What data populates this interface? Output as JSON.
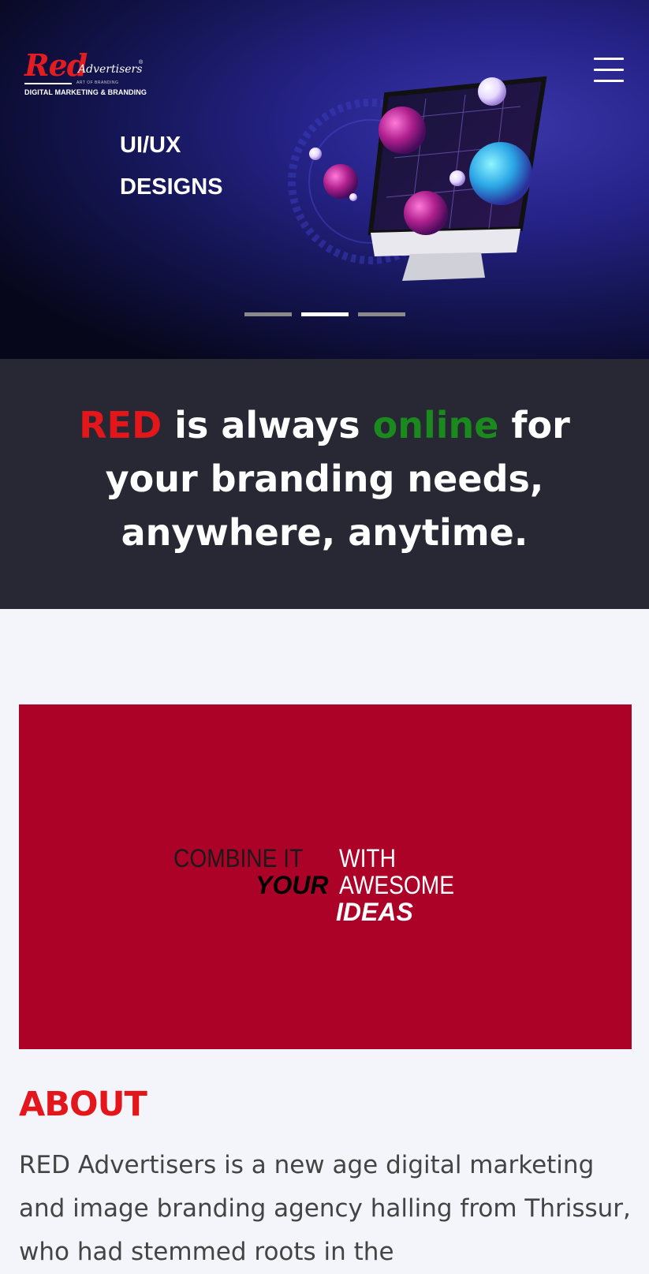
{
  "brand": {
    "logo_main": "Red",
    "logo_sub": "Advertisers",
    "logo_art": "ART OF BRANDING",
    "logo_tagline": "DIGITAL MARKETING & BRANDING"
  },
  "hero": {
    "slide_line1": "UI/UX",
    "slide_line2": "DESIGNS",
    "slides_total": 3,
    "active_slide": 2
  },
  "tagline": {
    "red_word": "RED",
    "part1": " is always ",
    "green_word": "online",
    "part2": " for",
    "line2": "your branding needs,",
    "line3": "anywhere, anytime."
  },
  "promo": {
    "line1_a": "COMBINE IT",
    "line1_b": "WITH",
    "line2_a": "YOUR",
    "line2_b": "AWESOME",
    "line3": "IDEAS"
  },
  "about": {
    "title": "ABOUT",
    "text": "RED Advertisers is a new age digital marketing and image branding agency halling from Thrissur, who had stemmed roots in the"
  },
  "colors": {
    "brand_red": "#e3161c",
    "online_green": "#1a8a1e",
    "promo_bg": "#ac0228",
    "tagline_bg": "#272833"
  }
}
